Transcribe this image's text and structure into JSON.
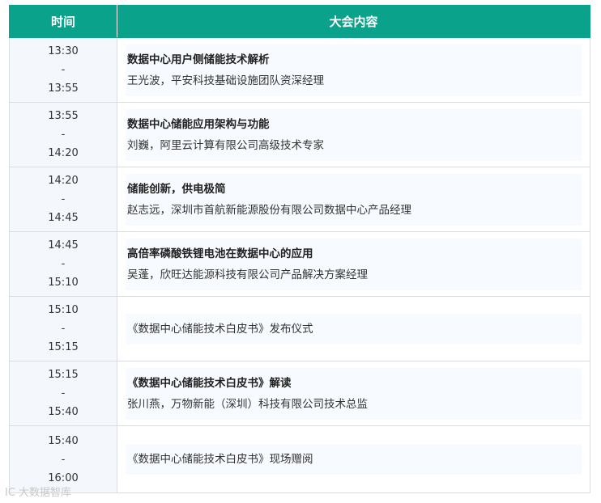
{
  "header": {
    "time_label": "时间",
    "content_label": "大会内容"
  },
  "rows": [
    {
      "start": "13:30",
      "sep": "-",
      "end": "13:55",
      "topic": "数据中心用户侧储能技术解析",
      "speaker": "王光波，平安科技基础设施团队资深经理"
    },
    {
      "start": "13:55",
      "sep": "-",
      "end": "14:20",
      "topic": "数据中心储能应用架构与功能",
      "speaker": "刘巍，阿里云计算有限公司高级技术专家"
    },
    {
      "start": "14:20",
      "sep": "-",
      "end": "14:45",
      "topic": "储能创新，供电极简",
      "speaker": "赵志远，深圳市首航新能源股份有限公司数据中心产品经理"
    },
    {
      "start": "14:45",
      "sep": "-",
      "end": "15:10",
      "topic": "高倍率磷酸铁锂电池在数据中心的应用",
      "speaker": "吴蓬，欣旺达能源科技有限公司产品解决方案经理"
    },
    {
      "start": "15:10",
      "sep": "-",
      "end": "15:15",
      "topic": "《数据中心储能技术白皮书》发布仪式",
      "speaker": ""
    },
    {
      "start": "15:15",
      "sep": "-",
      "end": "15:40",
      "topic": "《数据中心储能技术白皮书》解读",
      "speaker": "张川燕，万物新能（深圳）科技有限公司技术总监"
    },
    {
      "start": "15:40",
      "sep": "-",
      "end": "16:00",
      "topic": "《数据中心储能技术白皮书》现场赠阅",
      "speaker": ""
    }
  ],
  "watermark": "IC 大数据智库"
}
